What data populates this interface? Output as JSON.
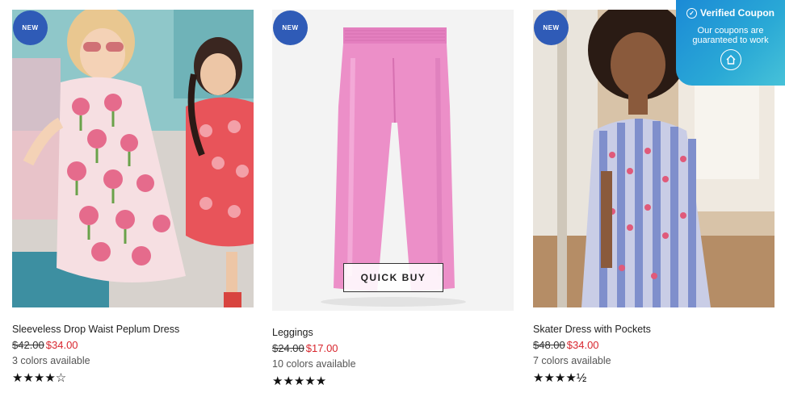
{
  "badge_label": "NEW",
  "quick_buy_label": "QUICK BUY",
  "coupon": {
    "title": "Verified Coupon",
    "message": "Our coupons are guaranteed to work"
  },
  "products": [
    {
      "name": "Sleeveless Drop Waist Peplum Dress",
      "old_price": "$42.00",
      "sale_price": "$34.00",
      "colors": "3 colors available",
      "stars": "★★★★☆",
      "rating": 4
    },
    {
      "name": "Leggings",
      "old_price": "$24.00",
      "sale_price": "$17.00",
      "colors": "10 colors available",
      "stars": "★★★★★",
      "rating": 5
    },
    {
      "name": "Skater Dress with Pockets",
      "old_price": "$48.00",
      "sale_price": "$34.00",
      "colors": "7 colors available",
      "stars": "★★★★½",
      "rating": 4.5
    }
  ],
  "colors": {
    "badge": "#2f5bb7",
    "sale_price": "#d8262e",
    "legging_pink": "#ec8fc8",
    "coupon_blue": "#1b8ad6"
  }
}
